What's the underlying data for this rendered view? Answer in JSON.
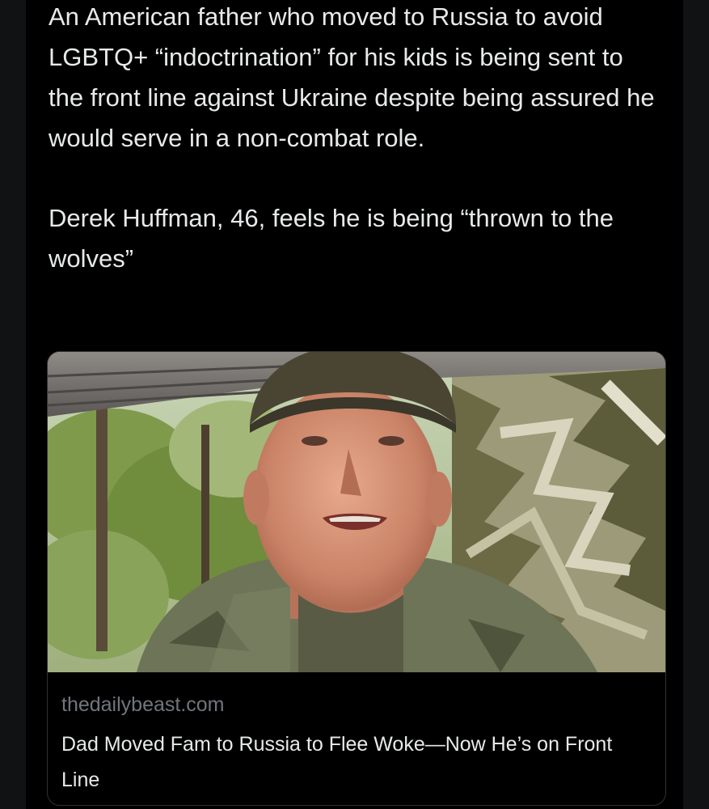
{
  "tweet": {
    "paragraph_1": "An American father who moved to Russia to avoid LGBTQ+ “indoctrination” for his kids is being sent to the front line against Ukraine despite being assured he would serve in a non-combat role.",
    "paragraph_2": "Derek Huffman, 46, feels he is being “thrown to the wolves”"
  },
  "link_card": {
    "domain": "thedailybeast.com",
    "headline": "Dad Moved Fam to Russia to Flee Woke—Now He’s on Front Line"
  },
  "colors": {
    "background": "#000000",
    "text_primary": "#e7e9ea",
    "text_secondary": "#71767b",
    "card_border": "#2f3336"
  }
}
